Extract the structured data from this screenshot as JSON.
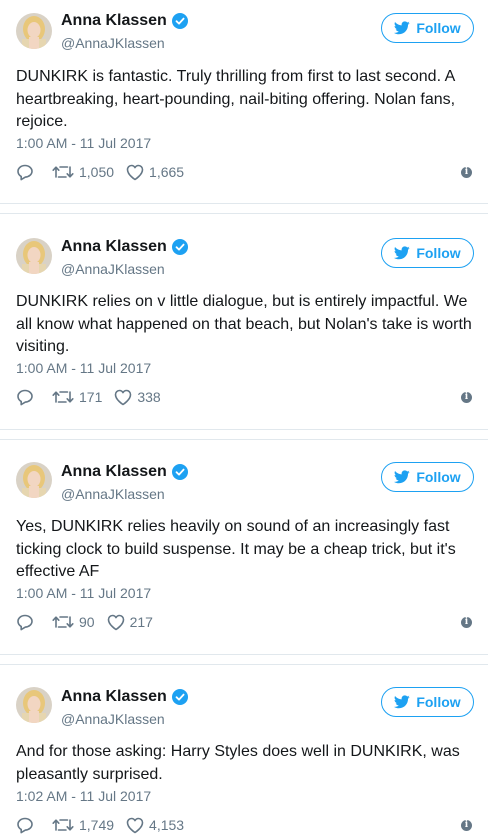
{
  "follow_label": "Follow",
  "colors": {
    "accent": "#1da1f2",
    "muted": "#657786",
    "text": "#14171a",
    "border": "#e1e8ed"
  },
  "tweets": [
    {
      "name": "Anna Klassen",
      "handle": "@AnnaJKlassen",
      "text": "DUNKIRK is fantastic. Truly thrilling from first to last second. A heartbreaking, heart-pounding, nail-biting offering. Nolan fans, rejoice.",
      "time": "1:00 AM - 11 Jul 2017",
      "retweets": "1,050",
      "likes": "1,665"
    },
    {
      "name": "Anna Klassen",
      "handle": "@AnnaJKlassen",
      "text": "DUNKIRK relies on v little dialogue, but is entirely impactful. We all know what happened on that beach, but Nolan's take is worth visiting.",
      "time": "1:00 AM - 11 Jul 2017",
      "retweets": "171",
      "likes": "338"
    },
    {
      "name": "Anna Klassen",
      "handle": "@AnnaJKlassen",
      "text": "Yes, DUNKIRK relies heavily on sound of an increasingly fast ticking clock to build suspense. It may be a cheap trick, but it's effective AF",
      "time": "1:00 AM - 11 Jul 2017",
      "retweets": "90",
      "likes": "217"
    },
    {
      "name": "Anna Klassen",
      "handle": "@AnnaJKlassen",
      "text": "And for those asking: Harry Styles does well in DUNKIRK, was pleasantly surprised.",
      "time": "1:02 AM - 11 Jul 2017",
      "retweets": "1,749",
      "likes": "4,153"
    }
  ],
  "icons": [
    "avatar",
    "verified-badge-icon",
    "twitter-bird-icon",
    "reply-icon",
    "retweet-icon",
    "heart-icon",
    "info-icon"
  ]
}
